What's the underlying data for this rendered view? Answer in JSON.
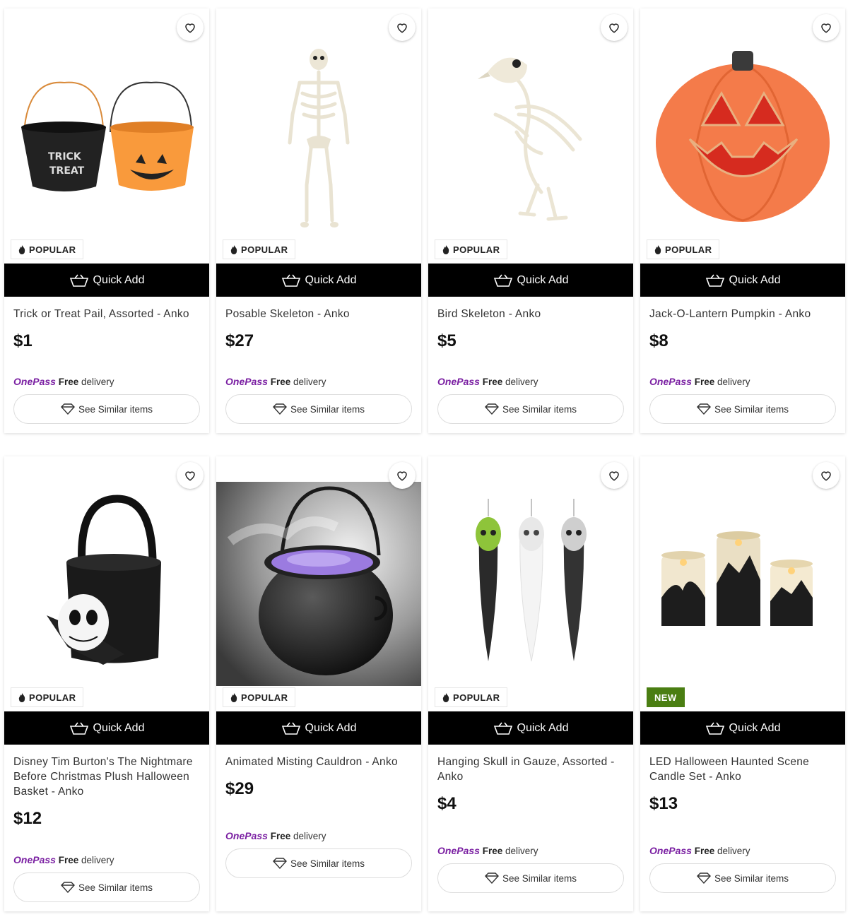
{
  "icons": {
    "favorite": "heart-outline-icon",
    "popular": "flame-icon",
    "quick_add": "basket-plus-icon",
    "similar": "diamond-icon"
  },
  "colors": {
    "quick_add_bg": "#000000",
    "onepass_brand": "#7a1fa2",
    "new_badge": "#4a7e12"
  },
  "labels": {
    "quick_add": "Quick Add",
    "see_similar": "See Similar items",
    "onepass_brand": "OnePass",
    "free": "Free",
    "delivery": "delivery"
  },
  "products": [
    {
      "name": "Trick or Treat Pail, Assorted - Anko",
      "price": "$1",
      "badge": "POPULAR"
    },
    {
      "name": "Posable Skeleton - Anko",
      "price": "$27",
      "badge": "POPULAR"
    },
    {
      "name": "Bird Skeleton - Anko",
      "price": "$5",
      "badge": "POPULAR"
    },
    {
      "name": "Jack-O-Lantern Pumpkin - Anko",
      "price": "$8",
      "badge": "POPULAR"
    },
    {
      "name": "Disney Tim Burton's The Nightmare Before Christmas Plush Halloween Basket - Anko",
      "price": "$12",
      "badge": "POPULAR"
    },
    {
      "name": "Animated Misting Cauldron - Anko",
      "price": "$29",
      "badge": "POPULAR"
    },
    {
      "name": "Hanging Skull in Gauze, Assorted - Anko",
      "price": "$4",
      "badge": "POPULAR"
    },
    {
      "name": "LED Halloween Haunted Scene Candle Set - Anko",
      "price": "$13",
      "badge": "NEW"
    }
  ]
}
